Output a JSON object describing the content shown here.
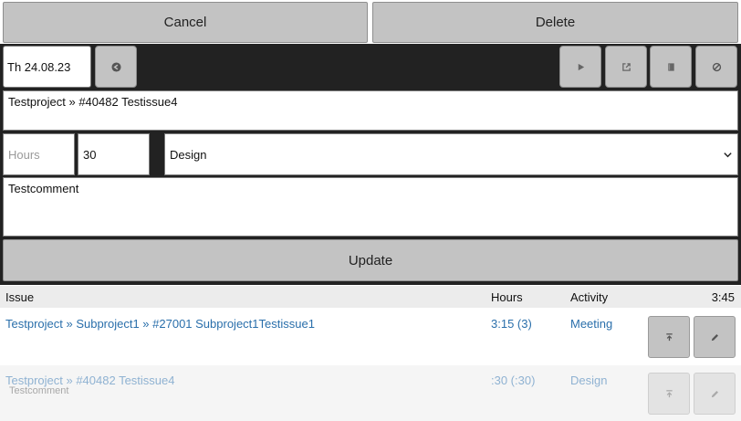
{
  "top_buttons": {
    "cancel": "Cancel",
    "delete": "Delete"
  },
  "editor": {
    "date": "Th 24.08.23",
    "issue": "Testproject » #40482 Testissue4",
    "hours_placeholder": "Hours",
    "minutes": "30",
    "activity_selected": "Design",
    "comment": "Testcomment",
    "update": "Update",
    "icons": [
      "clear-date-icon",
      "play-icon",
      "external-link-icon",
      "book-icon",
      "cancel-circle-icon"
    ]
  },
  "list": {
    "headers": {
      "issue": "Issue",
      "hours": "Hours",
      "activity": "Activity",
      "total": "3:45"
    },
    "rows": [
      {
        "issue": "Testproject » Subproject1 » #27001 Subproject1Testissue1",
        "hours": "3:15 (3)",
        "activity": "Meeting",
        "comment": ""
      },
      {
        "issue": "Testproject » #40482 Testissue4",
        "hours": ":30 (:30)",
        "activity": "Design",
        "comment": "Testcomment"
      }
    ]
  },
  "colors": {
    "editor_bg": "#222222",
    "button": "#c3c3c3",
    "link": "#2a6fab",
    "link_faded": "#8fb2d2"
  }
}
